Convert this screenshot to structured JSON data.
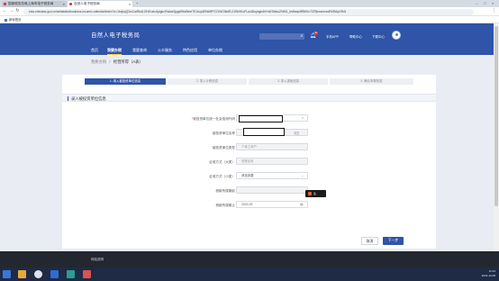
{
  "browser": {
    "tabs": [
      {
        "label": "国家税务总局上海市电子税务局"
      },
      {
        "label": "自然人电子税务局"
      }
    ],
    "url": "etax.chinatax.gov.cn/webstatic/business-income-calendar/index?s=1bxjkqQ3rcCarRkdL2ErEcsIvAjdgkcFAkdaSjqgbR6zBmeTEJAxpDRkbRPCCIWOlIkdR,21RkSKoFLwL8kqmgkdhYmESkfcuZ9Wl1_bMkeqkfRB0Kc7OPjkmcmcedRhRAqV9kl1",
    "bookmark": "新标签页"
  },
  "header": {
    "logo": "自然人电子税务局",
    "notification_count": "9+",
    "links": [
      "手机APP",
      "帮助中心",
      "下载中心"
    ],
    "menu": [
      "首页",
      "我要办税",
      "我要查询",
      "公众服务",
      "特色应用",
      "单位办税"
    ],
    "active_menu": "我要办税"
  },
  "breadcrumb": {
    "root": "我要办税",
    "separator": "/",
    "current": "经营所得（A表）"
  },
  "steps": [
    "1. 填入被投资单位信息",
    "2. 录入计税信息",
    "3. 录入减免信息",
    "4. 确认申报信息"
  ],
  "section": {
    "title": "录入被投资单位信息"
  },
  "form": {
    "credit_code": {
      "label": "被投资单位统一社会信用代码",
      "required_mark": "*",
      "value": ""
    },
    "name": {
      "label": "被投资单位名称",
      "value": "",
      "suffix": "清空"
    },
    "type": {
      "label": "被投资单位类型",
      "value": "个体工商户"
    },
    "method_big": {
      "label": "征收方式（大类）",
      "value": "查账征收"
    },
    "method_small": {
      "label": "征收方式（小类）",
      "value": "请选择要"
    },
    "period_start": {
      "label": "税款所属期起",
      "value": ""
    },
    "period_end": {
      "label": "税款所属期止",
      "value": "2022-09"
    }
  },
  "popup": {
    "text": "英 ·"
  },
  "buttons": {
    "cancel": "取消",
    "next": "下一步"
  },
  "footer": {
    "text": "网站说明"
  },
  "tray": {
    "time": "11:34",
    "date": "2022-10-08"
  }
}
